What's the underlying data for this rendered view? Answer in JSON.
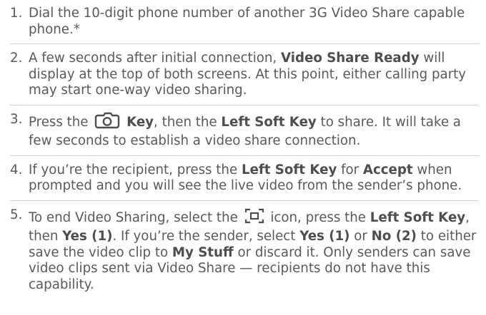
{
  "steps": [
    {
      "number": "1.",
      "p1": "Dial the 10-digit phone number of another 3G Video Share capable phone.*"
    },
    {
      "number": "2.",
      "p1": "A few seconds after initial connection, ",
      "b1": "Video Share Ready",
      "p2": " will display at the top of both screens. At this point, either calling party may start one-way video sharing."
    },
    {
      "number": "3.",
      "p1": "Press the ",
      "icon": "camera-icon",
      "b1": "Key",
      "p2": ", then the ",
      "b2": "Left Soft Key",
      "p3": " to share. It will take a few seconds to establish a video share connection."
    },
    {
      "number": "4.",
      "p1": "If you’re the recipient, press the ",
      "b1": "Left Soft Key",
      "p2": " for ",
      "b2": "Accept",
      "p3": " when prompted and you will see the live video from the sender’s phone."
    },
    {
      "number": "5.",
      "p1": "To end Video Sharing, select the ",
      "icon": "video-frame-icon",
      "p2": " icon, press the ",
      "b1": "Left Soft Key",
      "p3": ", then ",
      "b2": "Yes (1)",
      "p4": ". If you’re the sender, select ",
      "b3": "Yes (1)",
      "p5": " or ",
      "b4": "No (2)",
      "p6": " to either save the video clip to ",
      "b5": "My Stuff",
      "p7": " or discard it. Only senders can save video clips sent via Video Share — recipients do not have this capability."
    }
  ]
}
